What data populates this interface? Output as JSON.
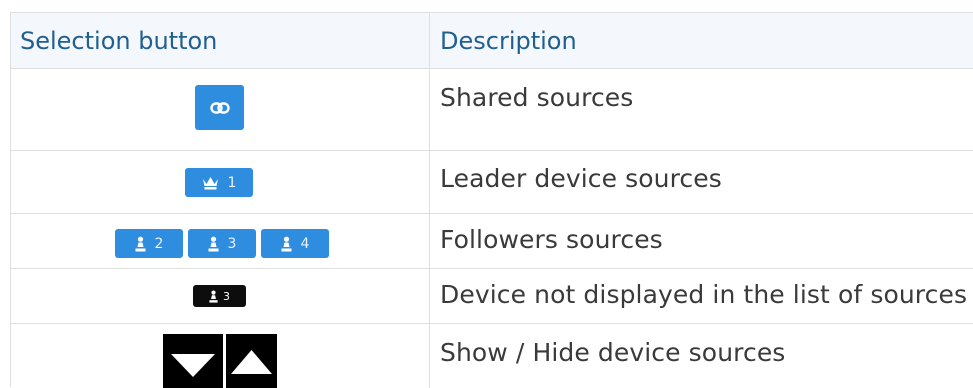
{
  "table": {
    "headers": {
      "selection": "Selection button",
      "description": "Description"
    },
    "rows": [
      {
        "icon": "link-icon",
        "description": "Shared sources"
      },
      {
        "icon": "crown-icon",
        "badge_number": "1",
        "description": "Leader device sources"
      },
      {
        "icon": "pawn-icon",
        "badge_numbers": [
          "2",
          "3",
          "4"
        ],
        "description": "Followers sources"
      },
      {
        "icon": "pawn-icon",
        "badge_number": "3",
        "description": "Device not displayed in the list of sources"
      },
      {
        "icons": [
          "triangle-down-icon",
          "triangle-up-icon"
        ],
        "description": "Show / Hide device sources"
      }
    ]
  },
  "colors": {
    "button_blue": "#2f8de0",
    "header_text": "#205f91",
    "header_bg": "#f4f8fc",
    "dark_button": "#0d0d0d"
  }
}
